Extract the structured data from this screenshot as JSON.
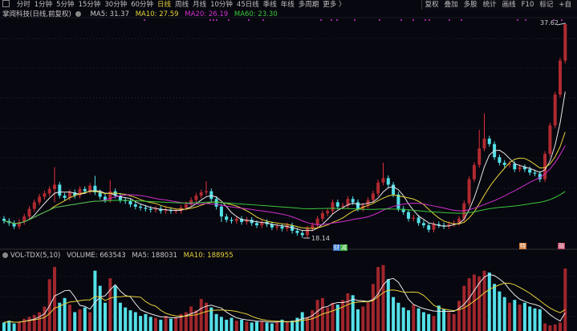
{
  "toolbar": {
    "periods": [
      "分时",
      "1分钟",
      "5分钟",
      "15分钟",
      "30分钟",
      "60分钟",
      "日线",
      "周线",
      "月线",
      "10分钟",
      "45日线",
      "季线",
      "年线",
      "多周期",
      "更多 〉"
    ],
    "active_period": "日线",
    "right_tools": [
      "复权",
      "叠加",
      "多股",
      "统计",
      "画线",
      "F10",
      "标记",
      "+自"
    ]
  },
  "legend": {
    "title": "掌阅科技(日线,前复权)",
    "ma5": "MA5: 31.37",
    "ma10": "MA10: 27.59",
    "ma20": "MA20: 26.19",
    "ma60": "MA60: 23.30"
  },
  "volume_legend": {
    "name": "VOL-TDX(5,10)",
    "volume": "VOLUME: 663543",
    "ma5": "MA5: 188031",
    "ma10": "MA10: 188955"
  },
  "markers": {
    "low_label": "18.14",
    "high_label": "37.62",
    "fin": "财",
    "reduce": "减",
    "special": "特",
    "margin": "融"
  },
  "colors": {
    "up": "#e0303a",
    "down": "#54e0e8",
    "ma5": "#e8e8e8",
    "ma10": "#e6d23a",
    "ma20": "#d030d0",
    "ma60": "#3cc83c",
    "bg": "#07070f"
  },
  "chart_data": {
    "type": "candlestick",
    "title": "掌阅科技(日线,前复权)",
    "ylim": [
      18.14,
      37.62
    ],
    "close": [
      19.7,
      19.5,
      19.2,
      19.6,
      20.1,
      20.8,
      21.4,
      21.9,
      22.2,
      22.6,
      23.0,
      22.0,
      21.8,
      22.3,
      22.0,
      22.6,
      22.4,
      22.9,
      22.3,
      21.9,
      21.6,
      22.4,
      22.0,
      21.6,
      21.5,
      21.2,
      21.0,
      20.9,
      20.8,
      20.7,
      20.8,
      20.6,
      20.7,
      20.6,
      20.6,
      20.9,
      21.2,
      21.6,
      22.0,
      22.3,
      22.4,
      21.7,
      21.0,
      20.1,
      19.8,
      19.7,
      19.9,
      19.6,
      19.8,
      19.5,
      19.3,
      19.6,
      19.4,
      19.1,
      19.2,
      19.0,
      19.3,
      18.8,
      18.6,
      18.4,
      19.0,
      19.3,
      19.9,
      20.4,
      20.6,
      21.4,
      21.0,
      21.1,
      21.7,
      21.4,
      20.8,
      21.1,
      21.6,
      22.2,
      23.2,
      23.6,
      23.0,
      22.1,
      20.8,
      20.5,
      19.9,
      20.0,
      19.5,
      19.3,
      18.9,
      19.4,
      19.3,
      19.2,
      19.4,
      19.5,
      19.9,
      21.3,
      23.5,
      24.8,
      26.3,
      27.2,
      26.7,
      25.5,
      25.0,
      24.8,
      24.9,
      24.4,
      24.6,
      24.4,
      24.1,
      24.0,
      23.5,
      25.8,
      28.4,
      31.2,
      34.3,
      37.62
    ],
    "first_open": 19.9,
    "high_overrides": {
      "10": 24.6,
      "18": 23.8,
      "21": 23.4,
      "40": 23.3,
      "75": 25.0,
      "95": 29.5,
      "94": 28.0,
      "111": 37.62
    },
    "low_overrides": {
      "59": 18.14,
      "10": 21.4,
      "43": 19.6
    },
    "volume": [
      90000,
      110000,
      80000,
      100000,
      130000,
      150000,
      170000,
      200000,
      260000,
      550000,
      680000,
      300000,
      350000,
      280000,
      200000,
      230000,
      250000,
      200000,
      640000,
      480000,
      300000,
      560000,
      480000,
      300000,
      250000,
      220000,
      200000,
      160000,
      180000,
      150000,
      140000,
      120000,
      160000,
      130000,
      150000,
      180000,
      200000,
      260000,
      220000,
      340000,
      300000,
      250000,
      180000,
      150000,
      120000,
      140000,
      110000,
      120000,
      100000,
      90000,
      100000,
      110000,
      90000,
      80000,
      100000,
      120000,
      90000,
      110000,
      140000,
      200000,
      150000,
      220000,
      330000,
      350000,
      250000,
      300000,
      280000,
      330000,
      400000,
      380000,
      230000,
      260000,
      300000,
      500000,
      680000,
      700000,
      550000,
      360000,
      300000,
      250000,
      220000,
      280000,
      240000,
      200000,
      180000,
      160000,
      270000,
      230000,
      200000,
      180000,
      320000,
      480000,
      560000,
      600000,
      580000,
      640000,
      620000,
      500000,
      420000,
      360000,
      300000,
      330000,
      280000,
      300000,
      260000,
      240000,
      230000,
      80000,
      60000,
      70000,
      90000,
      663543
    ],
    "ma_periods": [
      5,
      10,
      20,
      60
    ],
    "volume_ma_periods": [
      5,
      10
    ]
  }
}
